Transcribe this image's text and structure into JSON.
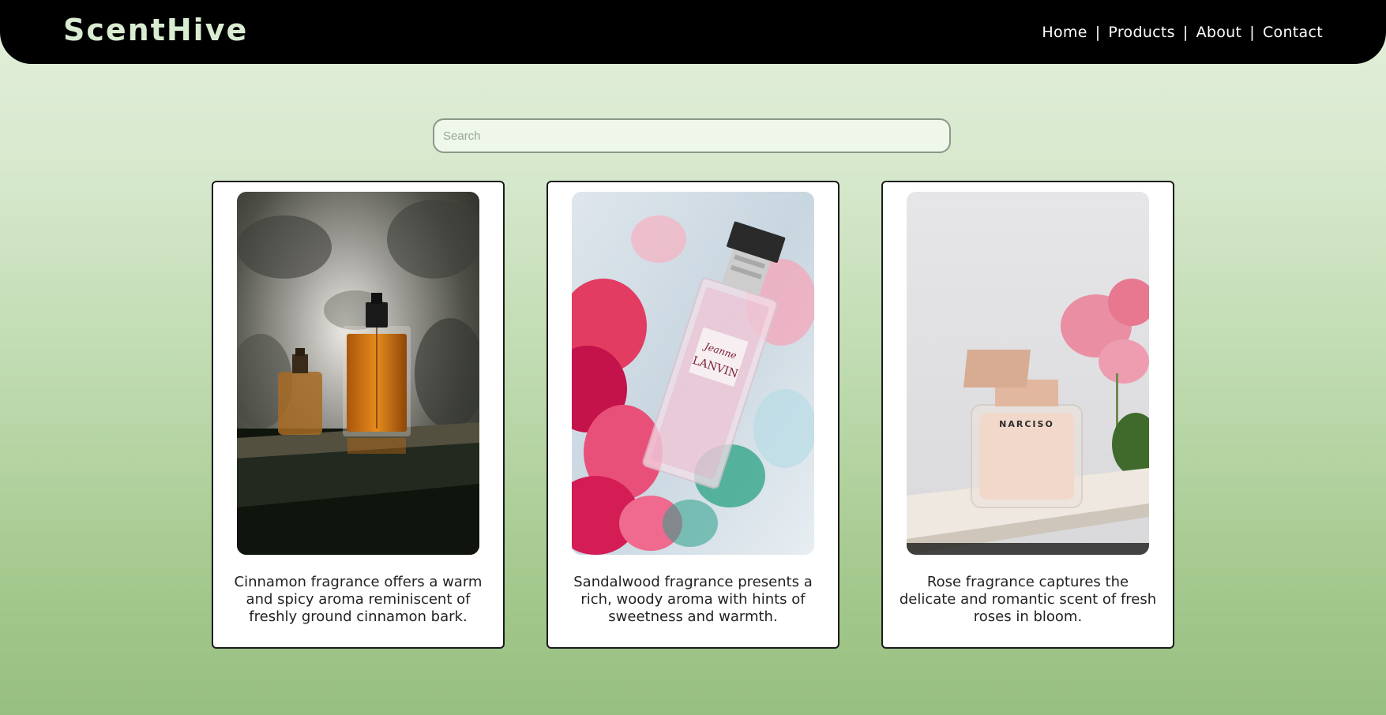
{
  "header": {
    "logo": "ScentHive",
    "nav": [
      {
        "label": "Home"
      },
      {
        "label": "Products"
      },
      {
        "label": "About"
      },
      {
        "label": "Contact"
      }
    ],
    "separator": "|"
  },
  "search": {
    "placeholder": "Search",
    "value": ""
  },
  "products": [
    {
      "image": "cinnamon-perfume-bottle-image",
      "description": "Cinnamon fragrance offers a warm and spicy aroma reminiscent of freshly ground cinnamon bark."
    },
    {
      "image": "lanvin-perfume-bottle-image",
      "bottle_label_script": "Jeanne",
      "bottle_label_brand": "LANVIN",
      "description": "Sandalwood fragrance presents a rich, woody aroma with hints of sweetness and warmth."
    },
    {
      "image": "narciso-perfume-bottle-image",
      "bottle_label_brand": "NARCISO",
      "description": "Rose fragrance captures the delicate and romantic scent of fresh roses in bloom."
    }
  ],
  "colors": {
    "navbar": "#000000",
    "logo": "#d9ecd2",
    "background_top": "#e4efdc",
    "background_bottom": "#98bf82",
    "card_border": "#1b1b1b"
  }
}
